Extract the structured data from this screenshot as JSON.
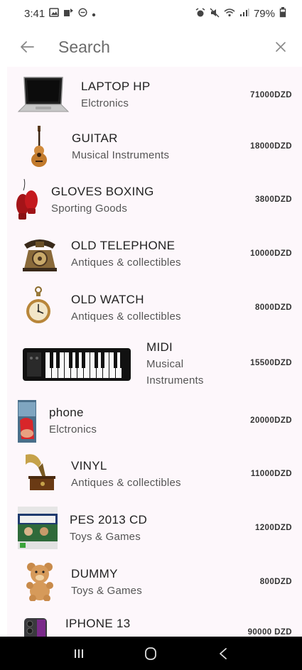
{
  "status_bar": {
    "time": "3:41",
    "battery": "79%"
  },
  "search": {
    "placeholder": "Search"
  },
  "items": [
    {
      "title": "LAPTOP HP",
      "category": "Elctronics",
      "price": "71000DZD",
      "icon": "laptop"
    },
    {
      "title": "GUITAR",
      "category": "Musical Instruments",
      "price": "18000DZD",
      "icon": "guitar"
    },
    {
      "title": "GLOVES BOXING",
      "category": "Sporting Goods",
      "price": "3800DZD",
      "icon": "boxing-gloves"
    },
    {
      "title": "OLD TELEPHONE",
      "category": "Antiques & collectibles",
      "price": "10000DZD",
      "icon": "telephone"
    },
    {
      "title": "OLD WATCH",
      "category": "Antiques & collectibles",
      "price": "8000DZD",
      "icon": "pocket-watch"
    },
    {
      "title": "MIDI",
      "category_line1": "Musical",
      "category_line2": "Instruments",
      "price": "15500DZD",
      "icon": "keyboard"
    },
    {
      "title": "phone",
      "category": "Elctronics",
      "price": "20000DZD",
      "icon": "phone"
    },
    {
      "title": "VINYL",
      "category": "Antiques & collectibles",
      "price": "11000DZD",
      "icon": "gramophone"
    },
    {
      "title": "PES 2013 CD",
      "category": "Toys & Games",
      "price": "1200DZD",
      "icon": "game-cover"
    },
    {
      "title": "DUMMY",
      "category": "Toys & Games",
      "price": "800DZD",
      "icon": "teddy-bear"
    },
    {
      "title": "IPHONE 13",
      "price": "90000 DZD",
      "icon": "iphone"
    }
  ]
}
